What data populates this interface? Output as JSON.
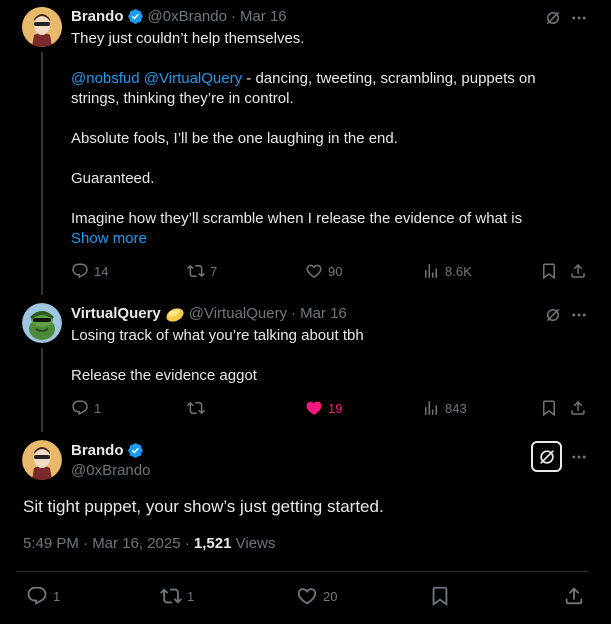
{
  "tweets": [
    {
      "display_name": "Brando",
      "handle": "@0xBrando",
      "date": "Mar 16",
      "separator": "·",
      "paragraphs": [
        "They just couldn’t help themselves.",
        "- dancing, tweeting, scrambling, puppets on strings, thinking they’re in control.",
        "Absolute fools, I’ll be the one laughing in the end.",
        "Guaranteed.",
        "Imagine how they’ll scramble when I release the evidence of what is"
      ],
      "mentions": [
        "@nobsfud",
        "@VirtualQuery"
      ],
      "show_more": "Show more",
      "replies": "14",
      "reposts": "7",
      "likes": "90",
      "views": "8.6K"
    },
    {
      "display_name": "VirtualQuery",
      "handle": "@VirtualQuery",
      "date": "Mar 16",
      "separator": "·",
      "paragraphs": [
        "Losing track of what you’re talking about tbh",
        "Release the evidence aggot"
      ],
      "replies": "1",
      "reposts": "",
      "likes": "19",
      "views": "843"
    }
  ],
  "main_tweet": {
    "display_name": "Brando",
    "handle": "@0xBrando",
    "text": "Sit tight puppet, your show’s just getting started.",
    "time": "5:49 PM · Mar 16, 2025 ·",
    "views_count": "1,521",
    "views_label": "Views",
    "replies": "1",
    "reposts": "1",
    "likes": "20"
  },
  "colors": {
    "background": "#000000",
    "text": "#e7e9ea",
    "muted": "#71767b",
    "link": "#1d9bf0",
    "like": "#f91880",
    "verified": "#1d9bf0"
  },
  "icons": [
    "grok-icon",
    "more-icon",
    "reply-icon",
    "repost-icon",
    "like-icon",
    "views-icon",
    "bookmark-icon",
    "share-icon",
    "verified-badge-icon"
  ]
}
